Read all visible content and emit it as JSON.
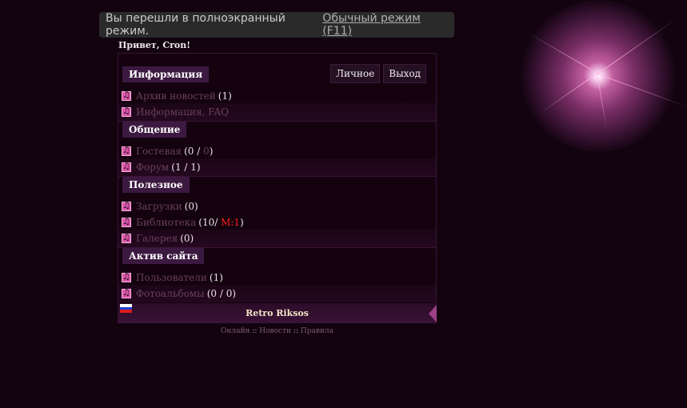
{
  "toast": {
    "message": "Вы перешли в полноэкранный режим.",
    "link": "Обычный режим (F11)"
  },
  "greeting": "Привет, Cron!",
  "top_buttons": {
    "personal": "Личное",
    "logout": "Выход"
  },
  "sections": [
    {
      "title": "Информация",
      "items": [
        {
          "label": "Архив новостей",
          "count": "(1)"
        },
        {
          "label": "Информация, FAQ",
          "count": ""
        }
      ]
    },
    {
      "title": "Общение",
      "items": [
        {
          "label": "Гостевая",
          "count_pre": "(0 / ",
          "count_hl": "0",
          "count_post": ")"
        },
        {
          "label": "Форум",
          "count": "(1 / 1)"
        }
      ]
    },
    {
      "title": "Полезное",
      "items": [
        {
          "label": "Загрузки",
          "count": "(0)"
        },
        {
          "label": "Библиотека",
          "count_pre": "(10/ ",
          "count_red": "M:1",
          "count_post": ")"
        },
        {
          "label": "Галерея",
          "count": "(0)"
        }
      ]
    },
    {
      "title": "Актив сайта",
      "items": [
        {
          "label": "Пользователи",
          "count": "(1)"
        },
        {
          "label": "Фотоальбомы",
          "count": "(0 / 0)"
        }
      ]
    }
  ],
  "footer": {
    "site_name": "Retro Riksos"
  },
  "bottom_links": {
    "online": "Онлайн",
    "news": "Новости",
    "rules": "Правила",
    "separator": "::"
  },
  "colors": {
    "accent": "#d857a6",
    "background": "#12030f",
    "highlight_red": "#ff1b1b"
  }
}
